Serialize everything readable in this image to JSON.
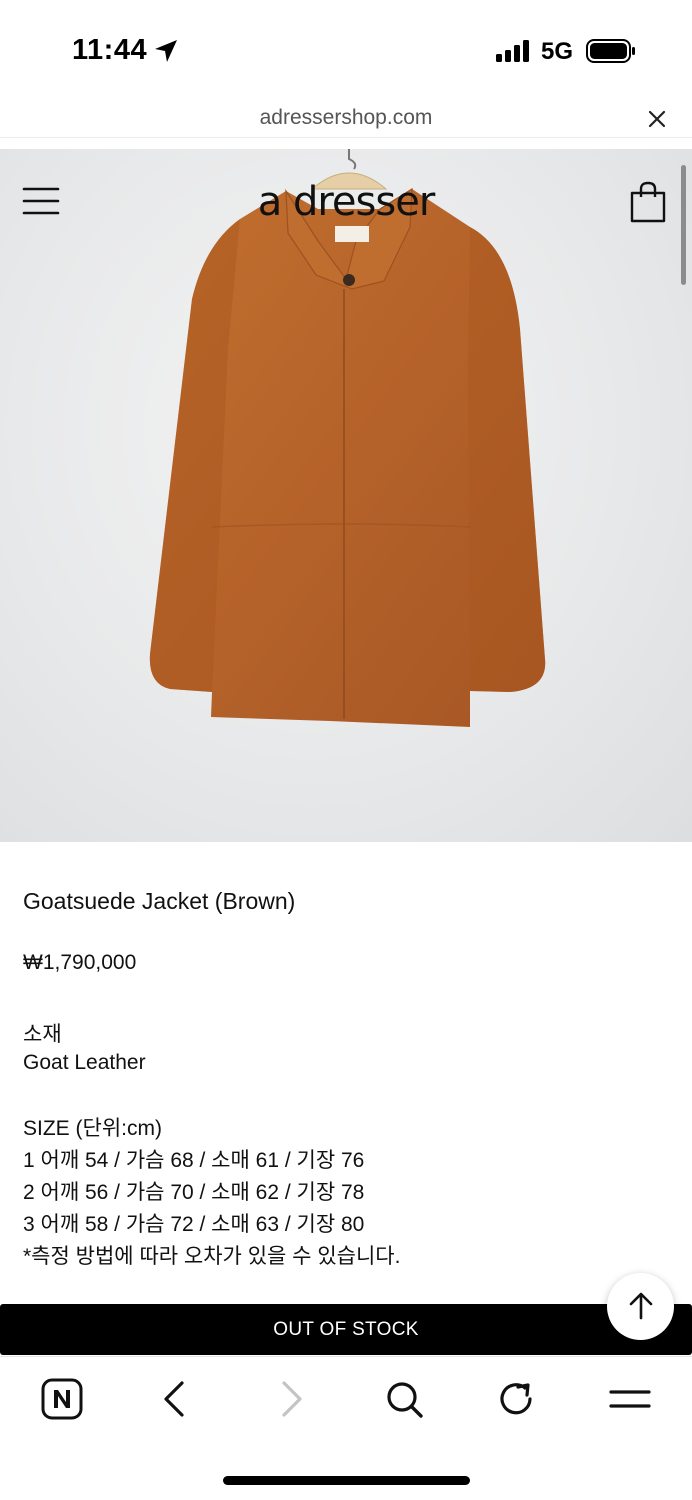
{
  "status_bar": {
    "time": "11:44",
    "network": "5G",
    "icons": [
      "location-arrow-icon",
      "signal-bars-icon",
      "battery-icon"
    ]
  },
  "browser": {
    "url": "adressershop.com",
    "close_icon": "close-icon"
  },
  "site_header": {
    "logo": "a dresser",
    "menu_icon": "hamburger-menu-icon",
    "cart_icon": "shopping-bag-icon"
  },
  "product": {
    "name": "Goatsuede Jacket (Brown)",
    "price": "₩1,790,000",
    "material_label": "소재",
    "material_value": "Goat Leather",
    "size_title": "SIZE (단위:cm)",
    "size_rows": [
      "1 어깨 54 / 가슴 68 / 소매 61 / 기장 76",
      "2 어깨 56 / 가슴 70 / 소매 62 / 기장 78",
      "3 어깨 58 / 가슴 72 / 소매 63 / 기장 80"
    ],
    "size_note": "*측정 방법에 따라 오차가 있을 수 있습니다.",
    "stock_button": "OUT OF STOCK",
    "image_colors": {
      "jacket": "#b8662c",
      "background": "#e8e9ea"
    }
  },
  "toolbar": {
    "items": [
      "naver-home-icon",
      "back-arrow-icon",
      "forward-arrow-icon",
      "search-icon",
      "reload-icon",
      "menu-icon"
    ]
  }
}
